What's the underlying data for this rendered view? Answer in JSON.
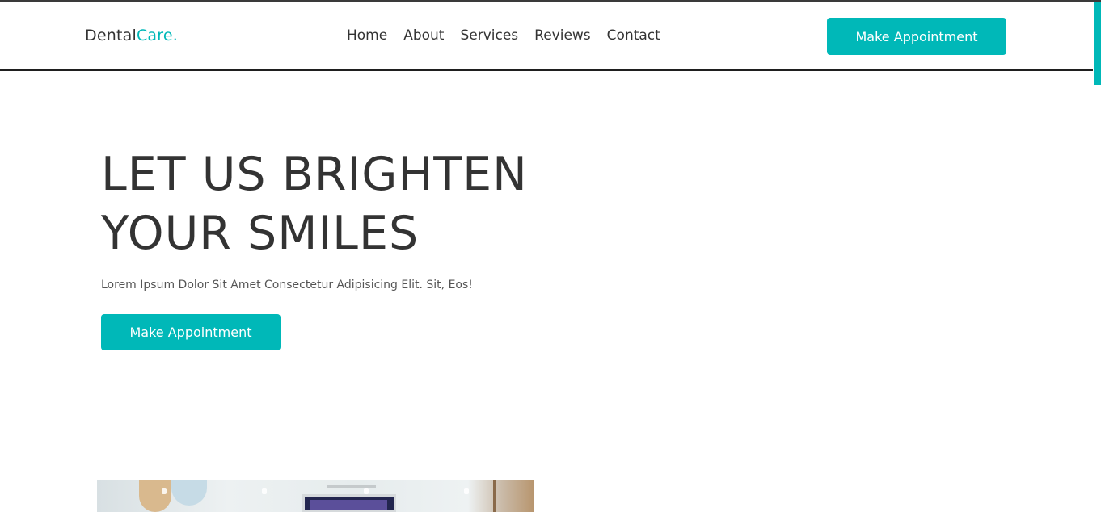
{
  "brand": {
    "logo_main": "Dental",
    "logo_accent": "Care."
  },
  "nav": {
    "items": [
      {
        "label": "Home"
      },
      {
        "label": "About"
      },
      {
        "label": "Services"
      },
      {
        "label": "Reviews"
      },
      {
        "label": "Contact"
      }
    ],
    "cta_label": "Make Appointment"
  },
  "hero": {
    "title_line_1": "LET US BRIGHTEN",
    "title_line_2": "YOUR SMILES",
    "subtitle": "Lorem Ipsum Dolor Sit Amet Consectetur Adipisicing Elit. Sit, Eos!",
    "cta_label": "Make Appointment"
  },
  "colors": {
    "accent": "#00b8b8",
    "text": "#333333",
    "background": "#ffffff"
  }
}
